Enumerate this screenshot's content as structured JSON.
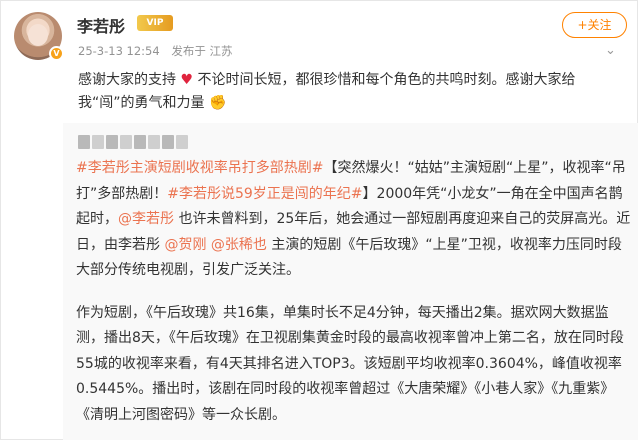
{
  "user": {
    "name": "李若彤",
    "vip_label": "VIP",
    "verified_label": "V",
    "timestamp": "25-3-13 12:54",
    "source": "发布于 江苏"
  },
  "follow_button": {
    "label": "+关注"
  },
  "more_icon": "chevron-down-icon",
  "post": {
    "text_a": "感谢大家的支持",
    "heart": "♥",
    "text_b": "不论时间长短，都很珍惜和每个角色的共鸣时刻。感谢大家给我“闯”的勇气和力量",
    "clap": "✊"
  },
  "quote": {
    "p1_tag1": "#李若彤主演短剧收视率吊打多部热剧#",
    "p1_text1": "【突然爆火！“姑姑”主演短剧“上星”，收视率“吊打”多部热剧！",
    "p1_tag2": "#李若彤说59岁正是闯的年纪#",
    "p1_text2": "】2000年凭“小龙女”一角在全中国声名鹊起时，",
    "p1_mention1": "@李若彤",
    "p1_text3": "也许未曾料到，25年后，她会通过一部短剧再度迎来自己的荧屏高光。近日，由李若彤",
    "p1_mention2": "@贺刚",
    "p1_mention3": "@张稀也",
    "p1_text4": "主演的短剧《午后玫瑰》“上星”卫视，收视率力压同时段大部分传统电视剧，引发广泛关注。",
    "p2_text": "作为短剧，《午后玫瑰》共16集，单集时长不足4分钟，每天播出2集。据欢网大数据监测，播出8天，《午后玫瑰》在卫视剧集黄金时段的最高收视率曾冲上第二名，放在同时段55城的收视率来看，有4天其排名进入TOP3。该短剧平均收视率0.3604%，峰值收视率0.5445%。播出时，该剧在同时段的收视率曾超过《大唐荣耀》《小巷人家》《九重紫》《清明上河图密码》等一众长剧。"
  },
  "colors": {
    "accent": "#ff8200",
    "link": "#eb7350",
    "heart": "#e0243e"
  }
}
